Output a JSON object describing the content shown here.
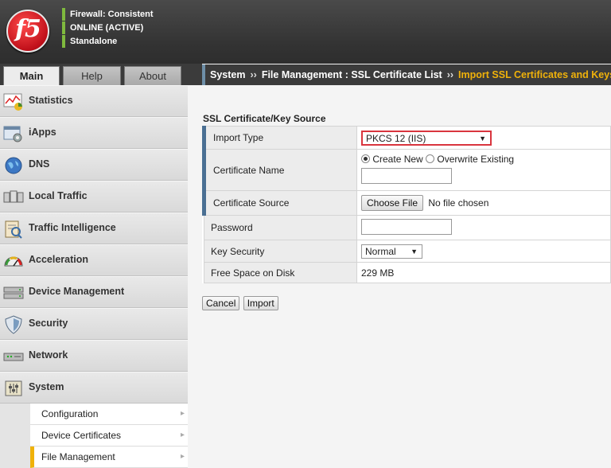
{
  "header": {
    "logo_text": "f5",
    "status_lines": [
      "Firewall: Consistent",
      "ONLINE (ACTIVE)",
      "Standalone"
    ],
    "status_color": "#7fb93e"
  },
  "tabs": [
    {
      "label": "Main",
      "active": true
    },
    {
      "label": "Help",
      "active": false
    },
    {
      "label": "About",
      "active": false
    }
  ],
  "breadcrumb": {
    "items": [
      "System",
      "File Management : SSL Certificate List"
    ],
    "separator": "››",
    "current": "Import SSL Certificates and Keys",
    "current_color": "#f0b20a"
  },
  "sidebar": {
    "items": [
      {
        "label": "Statistics",
        "icon": "statistics-icon"
      },
      {
        "label": "iApps",
        "icon": "iapps-icon"
      },
      {
        "label": "DNS",
        "icon": "globe-icon"
      },
      {
        "label": "Local Traffic",
        "icon": "local-traffic-icon"
      },
      {
        "label": "Traffic Intelligence",
        "icon": "traffic-intelligence-icon"
      },
      {
        "label": "Acceleration",
        "icon": "gauge-icon"
      },
      {
        "label": "Device Management",
        "icon": "device-management-icon"
      },
      {
        "label": "Security",
        "icon": "shield-icon"
      },
      {
        "label": "Network",
        "icon": "network-icon"
      },
      {
        "label": "System",
        "icon": "system-icon"
      }
    ],
    "sub_items": [
      {
        "label": "Configuration"
      },
      {
        "label": "Device Certificates"
      },
      {
        "label": "File Management",
        "active": true
      }
    ]
  },
  "form": {
    "section_title": "SSL Certificate/Key Source",
    "import_type": {
      "label": "Import Type",
      "value": "PKCS 12 (IIS)"
    },
    "certificate_name": {
      "label": "Certificate Name",
      "option_new": "Create New",
      "option_overwrite": "Overwrite Existing",
      "value": ""
    },
    "certificate_source": {
      "label": "Certificate Source",
      "button": "Choose File",
      "status": "No file chosen"
    },
    "password": {
      "label": "Password",
      "value": ""
    },
    "key_security": {
      "label": "Key Security",
      "value": "Normal"
    },
    "free_space": {
      "label": "Free Space on Disk",
      "value": "229 MB"
    }
  },
  "buttons": {
    "cancel": "Cancel",
    "import": "Import"
  }
}
